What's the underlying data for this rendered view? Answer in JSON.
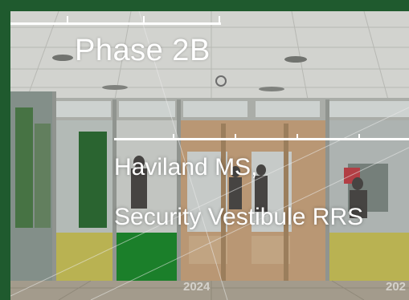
{
  "slide": {
    "title": "Phase 2B",
    "project_name": "Haviland MS,",
    "project_detail": "Security Vestibule RRS",
    "year_left": "2024",
    "year_right": "202"
  },
  "colors": {
    "frame": "#1f5a2e",
    "green_panel": "#1e8a2e",
    "yellow_panel": "#c9c25a",
    "door_wood": "#c9a47e",
    "text": "#ffffff"
  }
}
